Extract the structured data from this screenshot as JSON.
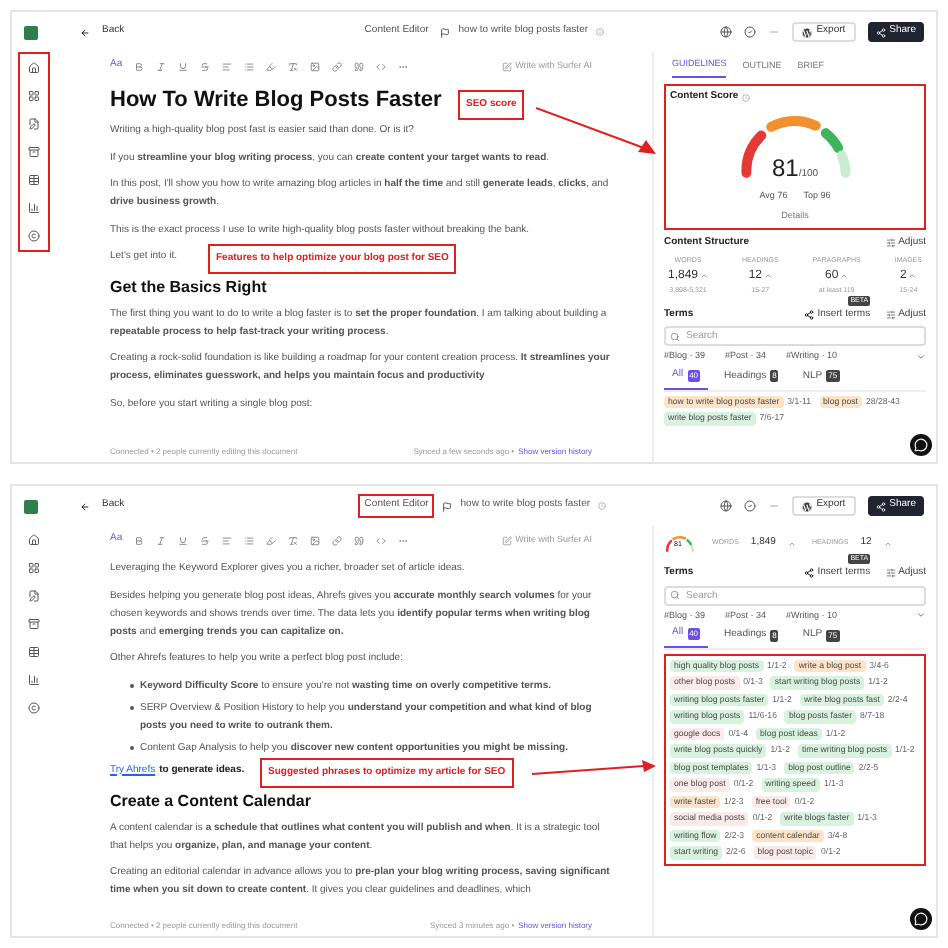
{
  "screens": [
    {
      "header": {
        "back": "Back",
        "editor_label": "Content Editor",
        "doc_title": "how to write blog posts faster",
        "export": "Export",
        "share": "Share"
      },
      "sidebar": {
        "highlighted": true
      },
      "toolbar": {
        "font": "Aa",
        "ai_button": "Write with Surfer AI"
      },
      "blocks": [
        {
          "kind": "h1",
          "text": "How To Write Blog Posts Faster"
        },
        {
          "kind": "p",
          "text": "Writing a high-quality blog post fast is easier said than done. Or is it?"
        },
        {
          "kind": "p",
          "text": "If you **streamline your blog writing process**, you can **create content your target wants to read**."
        },
        {
          "kind": "p",
          "text": "In this post, I'll show you how to write amazing blog articles in **half the time** and still **generate leads**, **clicks**, and **drive business growth**."
        },
        {
          "kind": "p",
          "text": "This is the exact process I use to write high-quality blog posts faster without breaking the bank."
        },
        {
          "kind": "p",
          "text": "Let's get into it."
        },
        {
          "kind": "h2",
          "text": "Get the Basics Right"
        },
        {
          "kind": "p",
          "text": "The first thing you want to do to write a blog faster is to **set the proper foundation**. I am talking about building a **repeatable process to help fast-track your writing process**."
        },
        {
          "kind": "p",
          "text": "Creating a rock-solid foundation is like building a roadmap for your content creation process. **It streamlines your process, eliminates guesswork, and helps you maintain focus and productivity**"
        },
        {
          "kind": "p",
          "text": "So, before you start writing a single blog post:"
        }
      ],
      "footer": {
        "status": "Connected • 2 people currently editing this document",
        "synced": "Synced a few seconds ago •",
        "history": "Show version history"
      },
      "annotations": [
        {
          "text": "SEO score"
        },
        {
          "text": "Features to help optimize your blog post for SEO"
        }
      ],
      "panel": {
        "tabs": [
          {
            "label": "GUIDELINES",
            "selected": true
          },
          {
            "label": "OUTLINE",
            "selected": false
          },
          {
            "label": "BRIEF",
            "selected": false
          }
        ],
        "score": {
          "kind": "full",
          "title": "Content Score",
          "value": "81",
          "max": "/100",
          "avg": "Avg 76",
          "top": "Top 96",
          "details": "Details",
          "highlighted": true
        },
        "structure": {
          "title": "Content Structure",
          "adjust": "Adjust",
          "metrics": [
            {
              "label": "WORDS",
              "value": "1,849",
              "range": "3,898-5,321"
            },
            {
              "label": "HEADINGS",
              "value": "12",
              "range": "15-27"
            },
            {
              "label": "PARAGRAPHS",
              "value": "60",
              "range": "at least 119"
            },
            {
              "label": "IMAGES",
              "value": "2",
              "range": "15-24"
            }
          ]
        },
        "terms": {
          "title": "Terms",
          "insert": "Insert terms",
          "beta": "BETA",
          "adjust": "Adjust",
          "search_placeholder": "Search",
          "filters": [
            "#Blog · 39",
            "#Post · 34",
            "#Writing · 10"
          ],
          "tabs": [
            {
              "label": "All",
              "count": "40",
              "selected": true
            },
            {
              "label": "Headings",
              "count": "8",
              "selected": false
            },
            {
              "label": "NLP",
              "count": "75",
              "selected": false
            }
          ],
          "chips": [
            {
              "text": "how to write blog posts faster",
              "count": "3/1-11",
              "color": "#fde4c8"
            },
            {
              "text": "blog post",
              "count": "28/28-43",
              "color": "#fde4c8"
            },
            {
              "text": "write blog posts faster",
              "count": "7/6-17",
              "color": "#d9f2df"
            }
          ]
        }
      }
    },
    {
      "header": {
        "back": "Back",
        "editor_label": "Content Editor",
        "editor_label_highlighted": true,
        "doc_title": "how to write blog posts faster",
        "export": "Export",
        "share": "Share"
      },
      "toolbar": {
        "font": "Aa",
        "ai_button": "Write with Surfer AI"
      },
      "blocks": [
        {
          "kind": "p",
          "text": "Leveraging the Keyword Explorer gives you a richer, broader set of article ideas."
        },
        {
          "kind": "p",
          "text": "Besides helping you generate blog post ideas, Ahrefs gives you **accurate monthly search volumes** for your chosen keywords and shows trends over time. The data lets you **identify popular terms when writing blog posts** and **emerging trends you can capitalize on.**"
        },
        {
          "kind": "p",
          "text": "Other Ahrefs features to help you write a perfect blog post include:"
        },
        {
          "kind": "li",
          "text": "**Keyword Difficulty Score** to ensure you're not **wasting time on overly competitive terms.**"
        },
        {
          "kind": "li",
          "text": "SERP Overview & Position History to help you **understand your competition and what kind of blog posts you need to write to outrank them.**"
        },
        {
          "kind": "li",
          "text": "Content Gap Analysis to help you **discover new content opportunities you might be missing.**"
        },
        {
          "kind": "link",
          "link": "Try Ahrefs",
          "text": "to generate ideas."
        },
        {
          "kind": "h2",
          "text": "Create a Content Calendar"
        },
        {
          "kind": "p",
          "text": "A content calendar is **a schedule that outlines what content you will publish and when**. It is a strategic tool that helps you **organize, plan, and manage your content**."
        },
        {
          "kind": "p",
          "text": "Creating an editorial calendar in advance allows you to **pre-plan your blog writing process, saving significant time when you sit down to create content**. It gives you clear guidelines and deadlines, which"
        }
      ],
      "footer": {
        "status": "Connected • 2 people currently editing this document",
        "synced": "Synced 3 minutes ago •",
        "history": "Show version history"
      },
      "annotations": [
        {
          "text": "Suggested phrases to optimize my article for SEO"
        }
      ],
      "panel": {
        "score": {
          "kind": "compact",
          "value": "81",
          "metrics": [
            {
              "label": "WORDS",
              "value": "1,849"
            },
            {
              "label": "HEADINGS",
              "value": "12"
            }
          ]
        },
        "terms": {
          "title": "Terms",
          "insert": "Insert terms",
          "beta": "BETA",
          "adjust": "Adjust",
          "search_placeholder": "Search",
          "filters": [
            "#Blog · 39",
            "#Post · 34",
            "#Writing · 10"
          ],
          "tabs": [
            {
              "label": "All",
              "count": "40",
              "selected": true
            },
            {
              "label": "Headings",
              "count": "8",
              "selected": false
            },
            {
              "label": "NLP",
              "count": "75",
              "selected": false
            }
          ],
          "highlighted": true,
          "chips": [
            {
              "text": "high quality blog posts",
              "count": "1/1-2",
              "color": "#d9f2df"
            },
            {
              "text": "write a blog post",
              "count": "3/4-6",
              "color": "#fde4c8"
            },
            {
              "text": "other blog posts",
              "count": "0/1-3",
              "color": "#fbeaea"
            },
            {
              "text": "start writing blog posts",
              "count": "1/1-2",
              "color": "#d9f2df"
            },
            {
              "text": "writing blog posts faster",
              "count": "1/1-2",
              "color": "#d9f2df"
            },
            {
              "text": "write blog posts fast",
              "count": "2/2-4",
              "color": "#d9f2df"
            },
            {
              "text": "writing blog posts",
              "count": "11/6-16",
              "color": "#d9f2df"
            },
            {
              "text": "blog posts faster",
              "count": "8/7-18",
              "color": "#d9f2df"
            },
            {
              "text": "google docs",
              "count": "0/1-4",
              "color": "#fbeaea"
            },
            {
              "text": "blog post ideas",
              "count": "1/1-2",
              "color": "#d9f2df"
            },
            {
              "text": "write blog posts quickly",
              "count": "1/1-2",
              "color": "#d9f2df"
            },
            {
              "text": "time writing blog posts",
              "count": "1/1-2",
              "color": "#d9f2df"
            },
            {
              "text": "blog post templates",
              "count": "1/1-3",
              "color": "#d9f2df"
            },
            {
              "text": "blog post outline",
              "count": "2/2-5",
              "color": "#d9f2df"
            },
            {
              "text": "one blog post",
              "count": "0/1-2",
              "color": "#fbeaea"
            },
            {
              "text": "writing speed",
              "count": "1/1-3",
              "color": "#d9f2df"
            },
            {
              "text": "write faster",
              "count": "1/2-3",
              "color": "#fde4c8"
            },
            {
              "text": "free tool",
              "count": "0/1-2",
              "color": "#fbeaea"
            },
            {
              "text": "social media posts",
              "count": "0/1-2",
              "color": "#fbeaea"
            },
            {
              "text": "write blogs faster",
              "count": "1/1-3",
              "color": "#d9f2df"
            },
            {
              "text": "writing flow",
              "count": "2/2-3",
              "color": "#d9f2df"
            },
            {
              "text": "content calendar",
              "count": "3/4-8",
              "color": "#fde4c8"
            },
            {
              "text": "start writing",
              "count": "2/2-6",
              "color": "#d9f2df"
            },
            {
              "text": "blog post topic",
              "count": "0/1-2",
              "color": "#fbeaea"
            }
          ]
        }
      }
    }
  ]
}
